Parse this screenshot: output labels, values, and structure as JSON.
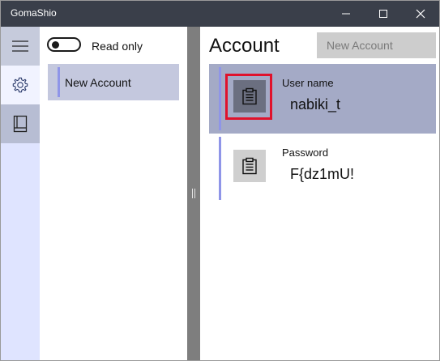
{
  "app": {
    "title": "GomaShio"
  },
  "window_controls": {
    "minimize": "minimize",
    "maximize": "maximize",
    "close": "close"
  },
  "rail": {
    "items": [
      {
        "icon": "hamburger-menu-icon"
      },
      {
        "icon": "gear-icon"
      },
      {
        "icon": "book-icon"
      }
    ]
  },
  "list": {
    "toggle_label": "Read only",
    "toggle_state": "off",
    "items": [
      {
        "label": "New Account"
      }
    ]
  },
  "detail": {
    "heading": "Account",
    "new_account_placeholder": "New Account",
    "fields": [
      {
        "label": "User name",
        "value": "nabiki_t",
        "icon": "clipboard-icon"
      },
      {
        "label": "Password",
        "value": "F{dz1mU!",
        "icon": "clipboard-icon"
      }
    ]
  },
  "colors": {
    "titlebar": "#3a3f4a",
    "rail": "#dfe4ff",
    "accent": "#8f95e8",
    "selected_field": "#a4aac6",
    "highlight": "#e0122c"
  }
}
